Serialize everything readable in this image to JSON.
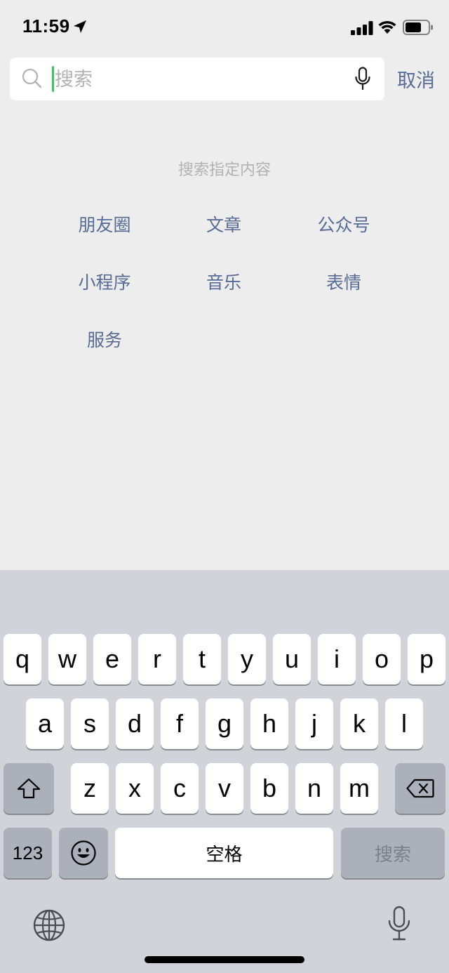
{
  "status_bar": {
    "time": "11:59",
    "location_icon": "location-arrow-icon",
    "signal_icon": "cellular-signal-icon",
    "wifi_icon": "wifi-icon",
    "battery_icon": "battery-icon"
  },
  "search": {
    "placeholder": "搜索",
    "value": "",
    "search_icon": "search-icon",
    "voice_icon": "microphone-icon",
    "cancel_label": "取消",
    "caret_color": "#3fc35f"
  },
  "search_hint": "搜索指定内容",
  "categories": [
    "朋友圈",
    "文章",
    "公众号",
    "小程序",
    "音乐",
    "表情",
    "服务"
  ],
  "colors": {
    "link": "#576b95",
    "hint": "#b2b2b2",
    "background": "#ededed",
    "keyboard_background": "#d1d3d9"
  },
  "keyboard": {
    "row1": [
      "q",
      "w",
      "e",
      "r",
      "t",
      "y",
      "u",
      "i",
      "o",
      "p"
    ],
    "row2": [
      "a",
      "s",
      "d",
      "f",
      "g",
      "h",
      "j",
      "k",
      "l"
    ],
    "row3": [
      "z",
      "x",
      "c",
      "v",
      "b",
      "n",
      "m"
    ],
    "shift_icon": "shift-arrow-icon",
    "delete_icon": "backspace-icon",
    "numbers_label": "123",
    "emoji_icon": "emoji-smiley-icon",
    "space_label": "空格",
    "search_key_label": "搜索",
    "globe_icon": "globe-icon",
    "dictation_icon": "microphone-icon"
  }
}
